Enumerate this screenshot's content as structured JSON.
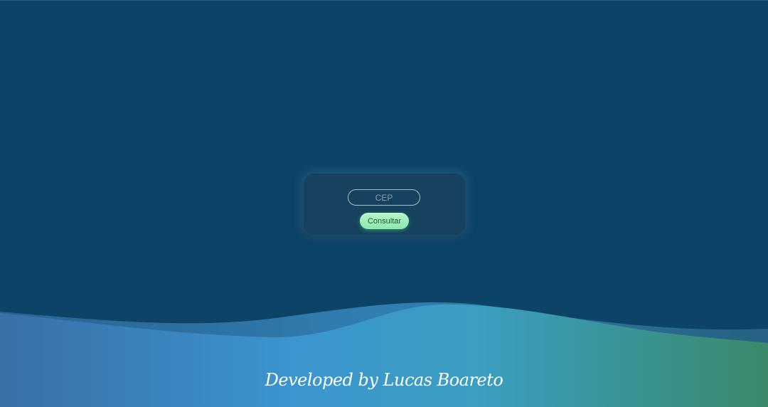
{
  "form": {
    "cep_placeholder": "CEP",
    "cep_value": "",
    "submit_label": "Consultar"
  },
  "footer": {
    "credit": "Developed by Lucas Boareto"
  },
  "colors": {
    "background": "#0e4368",
    "card": "#16415f",
    "button": "#a6f0bf",
    "button_text": "#1e5a3a",
    "wave_left": "#3a72a8",
    "wave_middle": "#3a96cc",
    "wave_right": "#3a8a6a"
  }
}
